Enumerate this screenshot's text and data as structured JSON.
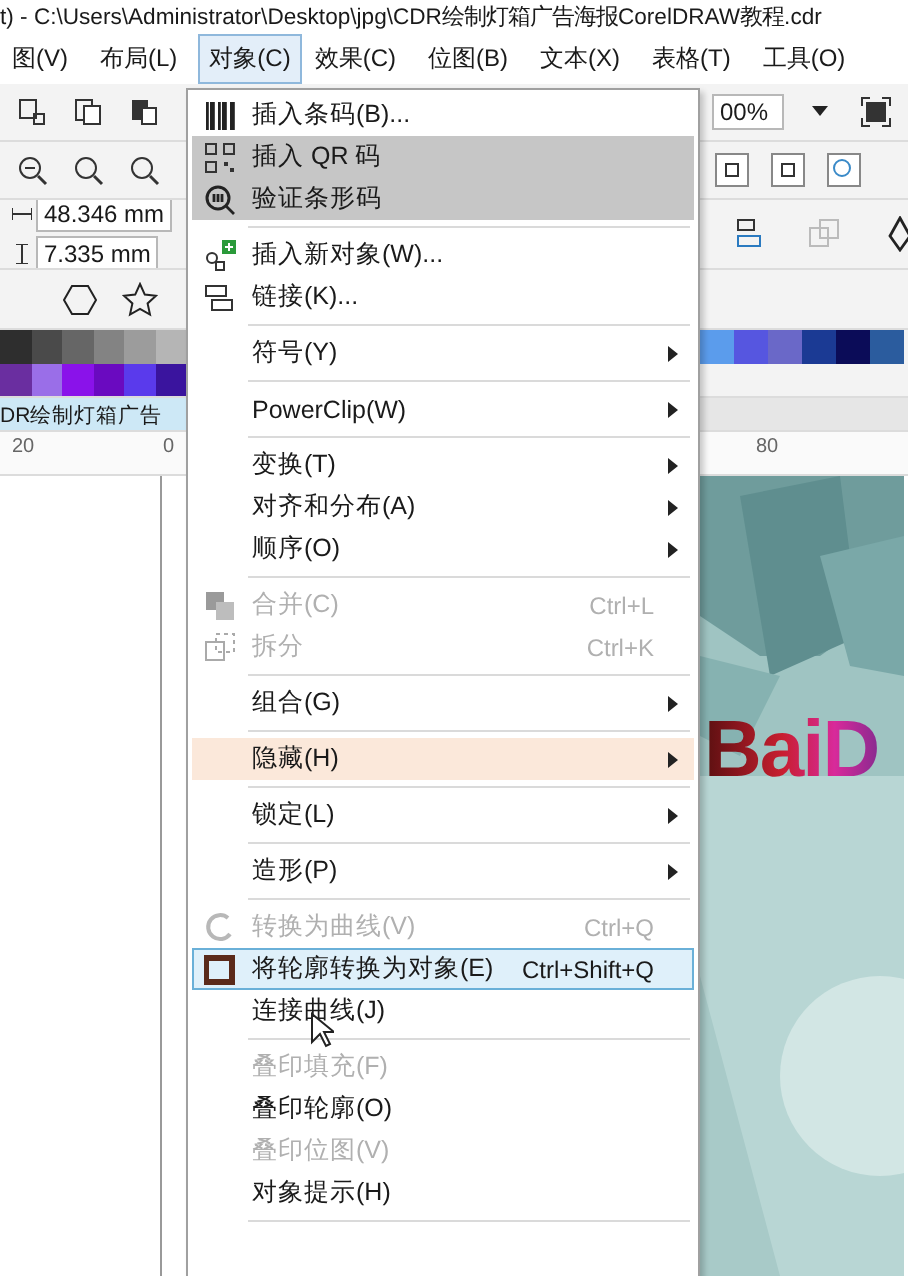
{
  "window": {
    "title": "t) - C:\\Users\\Administrator\\Desktop\\jpg\\CDR绘制灯箱广告海报CorelDRAW教程.cdr"
  },
  "menubar": [
    {
      "label": "图(V)",
      "selected": false
    },
    {
      "label": "布局(L)",
      "selected": false
    },
    {
      "label": "对象(C)",
      "selected": true
    },
    {
      "label": "效果(C)",
      "selected": false
    },
    {
      "label": "位图(B)",
      "selected": false
    },
    {
      "label": "文本(X)",
      "selected": false
    },
    {
      "label": "表格(T)",
      "selected": false
    },
    {
      "label": "工具(O)",
      "selected": false
    }
  ],
  "zoom_field": {
    "value": "00%"
  },
  "property_bar": {
    "width": "48.346 mm",
    "height": "7.335 mm"
  },
  "palette": {
    "left_rows": [
      [
        {
          "color": "#2e2e2e"
        },
        {
          "color": "#4a4a4a"
        },
        {
          "color": "#666666"
        },
        {
          "color": "#838383"
        },
        {
          "color": "#9c9c9c"
        },
        {
          "color": "#b5b5b5"
        }
      ],
      [
        {
          "color": "#6a2ea0"
        },
        {
          "color": "#9a6ee8"
        },
        {
          "color": "#8a12ea"
        },
        {
          "color": "#6a0ac0"
        },
        {
          "color": "#5a3aec"
        },
        {
          "color": "#3a149e"
        }
      ]
    ],
    "right_rows": [
      [
        {
          "color": "#5b9cec"
        },
        {
          "color": "#5656e0"
        },
        {
          "color": "#6a68c8"
        },
        {
          "color": "#1b3a94"
        },
        {
          "color": "#0b0c58"
        },
        {
          "color": "#2b5c9e"
        }
      ]
    ]
  },
  "document_tab": {
    "label": "DR绘制灯箱广告",
    "selected": true
  },
  "ruler": {
    "left_labels": [
      "20",
      "0"
    ],
    "right_labels": [
      "80"
    ]
  },
  "canvas": {
    "artwork_text": "BaiD"
  },
  "menu": [
    {
      "kind": "item",
      "label": "插入条码(B)...",
      "selected": false
    },
    {
      "kind": "item",
      "label": "插入 QR 码",
      "selected": false,
      "shaded": true
    },
    {
      "kind": "item",
      "label": "验证条形码",
      "selected": false,
      "shaded": true
    },
    {
      "kind": "separator"
    },
    {
      "kind": "item",
      "label": "插入新对象(W)...",
      "selected": false
    },
    {
      "kind": "item",
      "label": "链接(K)...",
      "selected": false
    },
    {
      "kind": "separator"
    },
    {
      "kind": "item",
      "label": "符号(Y)",
      "submenu": true,
      "selected": false
    },
    {
      "kind": "separator"
    },
    {
      "kind": "item",
      "label": "PowerClip(W)",
      "submenu": true,
      "selected": false
    },
    {
      "kind": "separator"
    },
    {
      "kind": "item",
      "label": "变换(T)",
      "submenu": true,
      "selected": false
    },
    {
      "kind": "item",
      "label": "对齐和分布(A)",
      "submenu": true,
      "selected": false
    },
    {
      "kind": "item",
      "label": "顺序(O)",
      "submenu": true,
      "selected": false
    },
    {
      "kind": "separator"
    },
    {
      "kind": "item",
      "label": "合并(C)",
      "shortcut": "Ctrl+L",
      "disabled": true,
      "selected": false
    },
    {
      "kind": "item",
      "label": "拆分",
      "shortcut": "Ctrl+K",
      "disabled": true,
      "selected": false
    },
    {
      "kind": "separator"
    },
    {
      "kind": "item",
      "label": "组合(G)",
      "submenu": true,
      "selected": false
    },
    {
      "kind": "separator"
    },
    {
      "kind": "item",
      "label": "隐藏(H)",
      "submenu": true,
      "selected": false,
      "hovered": true
    },
    {
      "kind": "separator"
    },
    {
      "kind": "item",
      "label": "锁定(L)",
      "submenu": true,
      "selected": false
    },
    {
      "kind": "separator"
    },
    {
      "kind": "item",
      "label": "造形(P)",
      "submenu": true,
      "selected": false
    },
    {
      "kind": "separator"
    },
    {
      "kind": "item",
      "label": "转换为曲线(V)",
      "shortcut": "Ctrl+Q",
      "disabled": true,
      "selected": false
    },
    {
      "kind": "item",
      "label": "将轮廓转换为对象(E)",
      "shortcut": "Ctrl+Shift+Q",
      "selected": true
    },
    {
      "kind": "item",
      "label": "连接曲线(J)",
      "selected": false
    },
    {
      "kind": "separator"
    },
    {
      "kind": "item",
      "label": "叠印填充(F)",
      "disabled": true,
      "selected": false
    },
    {
      "kind": "item",
      "label": "叠印轮廓(O)",
      "selected": false
    },
    {
      "kind": "item",
      "label": "叠印位图(V)",
      "disabled": true,
      "selected": false
    },
    {
      "kind": "item",
      "label": "对象提示(H)",
      "selected": false
    },
    {
      "kind": "separator"
    }
  ]
}
